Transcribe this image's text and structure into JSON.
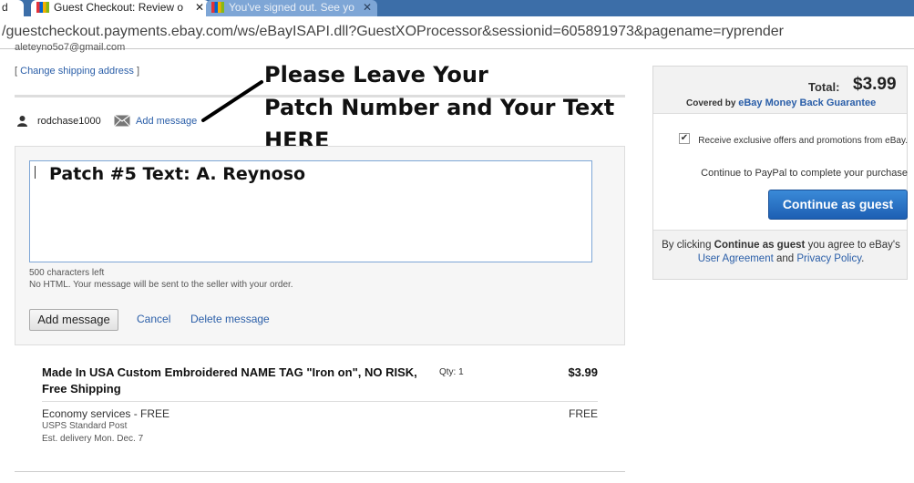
{
  "browser": {
    "tabs": [
      {
        "title": "d"
      },
      {
        "title": "Guest Checkout: Review o"
      },
      {
        "title": "You've signed out. See yo"
      }
    ],
    "url": "/guestcheckout.payments.ebay.com/ws/eBayISAPI.dll?GuestXOProcessor&sessionid=605891973&pagename=ryprender"
  },
  "shipping": {
    "email": "aleteyno5o7@gmail.com",
    "bracket_open": "[",
    "change_link": "Change shipping address",
    "bracket_close": "]"
  },
  "seller_message": {
    "username": "rodchase1000",
    "add_message_link": "Add message",
    "textarea_value": "Patch #5 Text: A. Reynoso",
    "chars_left": "500 characters left",
    "note": "No HTML. Your message will be sent to the seller with your order.",
    "add_button": "Add message",
    "cancel_link": "Cancel",
    "delete_link": "Delete message"
  },
  "annotation": {
    "line1": "Please Leave Your",
    "line2": "Patch Number and Your Text",
    "line3": "HERE"
  },
  "item": {
    "title": "Made In USA Custom Embroidered NAME TAG \"Iron on\", NO RISK, Free Shipping",
    "qty": "Qty: 1",
    "price": "$3.99",
    "shipping_label": "Economy services - FREE",
    "shipping_price": "FREE",
    "shipping_method": "USPS Standard Post",
    "delivery": "Est. delivery Mon. Dec. 7"
  },
  "summary": {
    "total_label": "Total:",
    "total_value": "$3.99",
    "covered_prefix": "Covered by",
    "covered_link": "eBay Money Back Guarantee",
    "offers_text": "Receive exclusive offers and promotions from eBay.",
    "offers_checked": true,
    "checkmark": "✔",
    "continue_note": "Continue to PayPal to complete your purchase",
    "continue_button": "Continue as guest",
    "terms_1": "By clicking",
    "terms_bold": "Continue as guest",
    "terms_2": "you agree to eBay's",
    "terms_link1": "User Agreement",
    "terms_and": "and",
    "terms_link2": "Privacy Policy",
    "terms_end": "."
  },
  "colors": {
    "link": "#2a5ea8",
    "button_primary": "#1d5fb3",
    "tab_bar": "#3c6ea8"
  }
}
